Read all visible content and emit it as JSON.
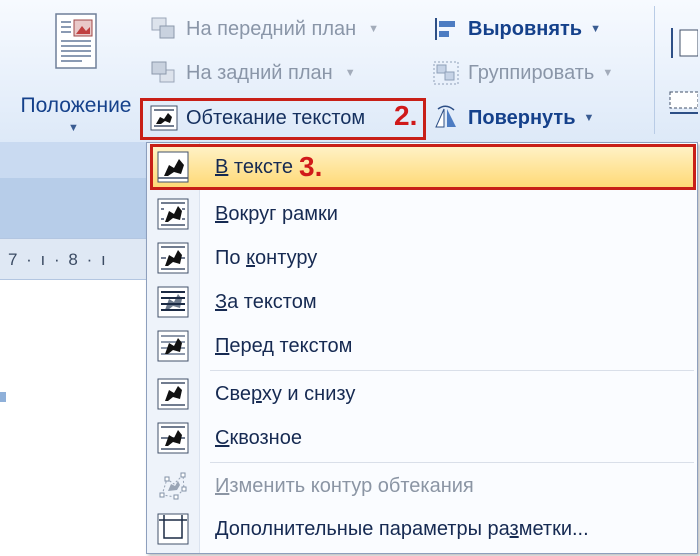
{
  "ribbon": {
    "position": {
      "label": "Положение",
      "icon": "page-position-icon"
    },
    "bring_forward": {
      "label": "На передний план",
      "icon": "bring-forward-icon"
    },
    "send_backward": {
      "label": "На задний план",
      "icon": "send-backward-icon"
    },
    "text_wrapping": {
      "label": "Обтекание текстом",
      "icon": "text-wrap-icon",
      "step": "2."
    },
    "align": {
      "label": "Выровнять",
      "icon": "align-icon"
    },
    "group": {
      "label": "Группировать",
      "icon": "group-icon"
    },
    "rotate": {
      "label": "Повернуть",
      "icon": "rotate-icon"
    }
  },
  "ruler": {
    "text": "7 · ı · 8 · ı"
  },
  "menu": {
    "items": [
      {
        "label_ul": "В",
        "label_rest": " тексте",
        "icon": "wrap-inline-icon",
        "selected": true,
        "step": "3."
      },
      {
        "label_ul": "В",
        "label_rest": "округ рамки",
        "icon": "wrap-square-icon"
      },
      {
        "label_pre": "По ",
        "label_ul": "к",
        "label_rest": "онтуру",
        "icon": "wrap-tight-icon"
      },
      {
        "label_ul": "З",
        "label_rest": "а текстом",
        "icon": "wrap-behind-icon"
      },
      {
        "label_ul": "П",
        "label_rest": "еред текстом",
        "icon": "wrap-front-icon"
      },
      {
        "label_pre": "Све",
        "label_ul": "р",
        "label_rest": "ху и снизу",
        "icon": "wrap-top-bottom-icon"
      },
      {
        "label_ul": "С",
        "label_rest": "квозное",
        "icon": "wrap-through-icon"
      },
      {
        "label_ul": "И",
        "label_rest": "зменить контур обтекания",
        "icon": "edit-wrap-points-icon",
        "disabled": true
      },
      {
        "label_pre": "Дополнительные параметры ра",
        "label_ul": "з",
        "label_rest": "метки...",
        "icon": "more-layout-options-icon"
      }
    ]
  },
  "colors": {
    "accent_red": "#c81f17",
    "highlight": "#ffd974",
    "ribbon_text": "#15418b"
  }
}
